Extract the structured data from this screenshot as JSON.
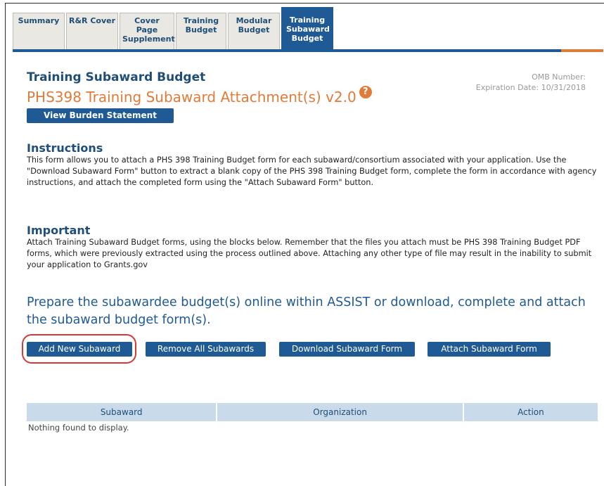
{
  "tabs": [
    "Summary",
    "R&R Cover",
    "Cover Page Supplement",
    "Training Budget",
    "Modular Budget",
    "Training Subaward Budget"
  ],
  "active_tab": "Training Subaward Budget",
  "header": {
    "form_title": "Training Subaward Budget",
    "phs_title": "PHS398 Training Subaward Attachment(s) v2.0",
    "help_icon": "?",
    "omb_number": "OMB Number:",
    "expiration": "Expiration Date: 10/31/2018",
    "burden_button": "View Burden Statement"
  },
  "instructions": {
    "heading": "Instructions",
    "text": "This form allows you to attach a PHS 398 Training Budget form for each subaward/consortium associated with your application. Use the \"Download Subaward Form\" button to extract a blank copy of the PHS 398 Training Budget form, complete the form in accordance with agency instructions, and attach the completed form using the \"Attach Subaward Form\" button."
  },
  "important": {
    "heading": "Important",
    "text": "Attach Training Subaward Budget forms, using the blocks below. Remember that the files you attach must be PHS 398 Training Budget PDF forms, which were previously extracted using the process outlined above. Attaching any other type of file may result in the inability to submit your application to Grants.gov"
  },
  "prepare_text": "Prepare the subawardee budget(s) online within ASSIST or download, complete and attach the subaward budget form(s).",
  "actions": {
    "add": "Add New Subaward",
    "remove_all": "Remove All Subawards",
    "download": "Download Subaward Form",
    "attach": "Attach Subaward Form"
  },
  "table": {
    "columns": [
      "Subaward",
      "Organization",
      "Action"
    ],
    "empty_text": "Nothing found to display."
  },
  "colors": {
    "primary": "#1f5a94",
    "accent": "#e07b39",
    "callout": "#d43a3a",
    "header_bg": "#c9daea"
  }
}
